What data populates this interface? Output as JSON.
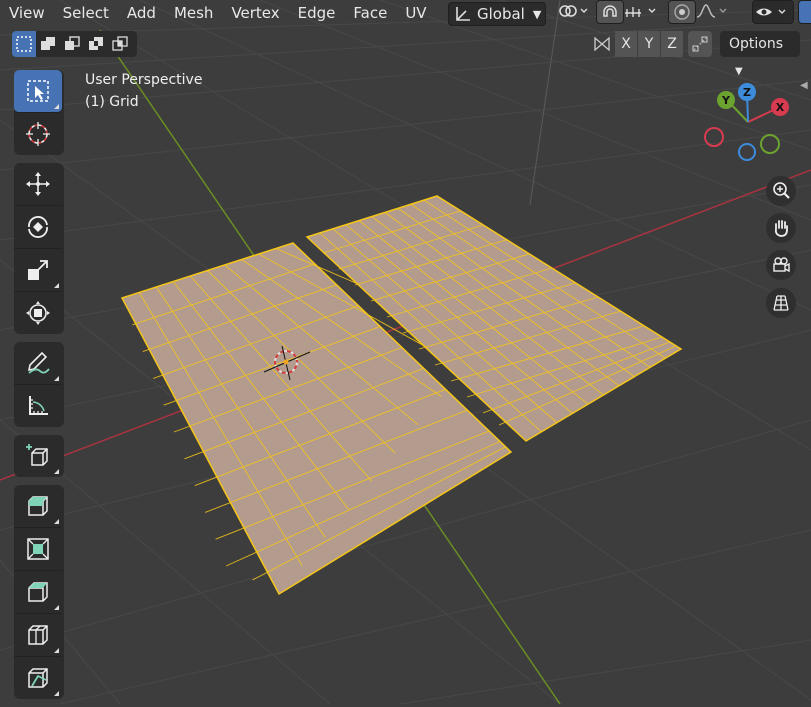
{
  "menu": {
    "items": [
      "View",
      "Select",
      "Add",
      "Mesh",
      "Vertex",
      "Edge",
      "Face",
      "UV"
    ]
  },
  "header": {
    "transform_orientation": "Global",
    "axis_x": "X",
    "axis_y": "Y",
    "axis_z": "Z",
    "options_label": "Options"
  },
  "viewport": {
    "perspective_label": "User Perspective",
    "object_label": "(1) Grid"
  },
  "gizmo": {
    "x_label": "X",
    "y_label": "Y",
    "z_label": "Z",
    "x_color": "#d73b50",
    "y_color": "#6ca22f",
    "z_color": "#3d8cdc"
  },
  "colors": {
    "background": "#3d3d3d",
    "mesh_face": "#b39c8e",
    "mesh_edge": "#f5c518",
    "active_tool": "#4772b3"
  },
  "tools": {
    "group1": [
      "select-box-icon",
      "cursor-icon"
    ],
    "group2": [
      "move-icon",
      "rotate-icon",
      "scale-icon",
      "transform-icon"
    ],
    "group3": [
      "annotate-icon",
      "measure-icon"
    ],
    "group4": [
      "add-cube-icon"
    ],
    "group5": [
      "extrude-icon",
      "inset-icon",
      "bevel-icon",
      "loop-cut-icon",
      "knife-icon"
    ]
  }
}
